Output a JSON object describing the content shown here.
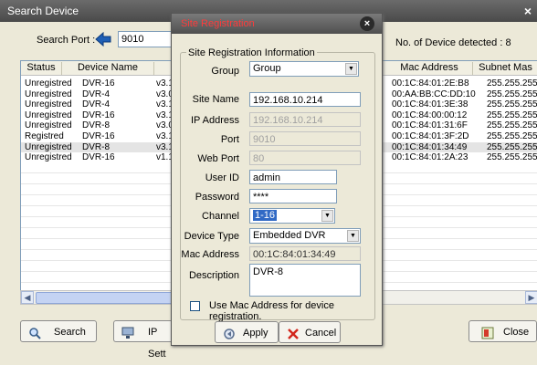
{
  "window": {
    "title": "Search Device",
    "close": "×"
  },
  "search": {
    "port_label": "Search Port :",
    "port_value": "9010",
    "detected_text": "No. of Device detected : 8"
  },
  "table": {
    "headers": [
      "Status",
      "Device Name",
      "",
      "Mac Address",
      "Subnet Mas"
    ],
    "rows": [
      {
        "status": "Unregistred",
        "name": "DVR-16",
        "ver": "v3.1",
        "mac": "00:1C:84:01:2E:B8",
        "subnet": "255.255.255"
      },
      {
        "status": "Unregistred",
        "name": "DVR-4",
        "ver": "v3.0",
        "mac": "00:AA:BB:CC:DD:10",
        "subnet": "255.255.255"
      },
      {
        "status": "Unregistred",
        "name": "DVR-4",
        "ver": "v3.1",
        "mac": "00:1C:84:01:3E:38",
        "subnet": "255.255.255"
      },
      {
        "status": "Unregistred",
        "name": "DVR-16",
        "ver": "v3.1",
        "mac": "00:1C:84:00:00:12",
        "subnet": "255.255.255"
      },
      {
        "status": "Unregistred",
        "name": "DVR-8",
        "ver": "v3.0",
        "mac": "00:1C:84:01:31:6F",
        "subnet": "255.255.255"
      },
      {
        "status": "Registred",
        "name": "DVR-16",
        "ver": "v3.1",
        "mac": "00:1C:84:01:3F:2D",
        "subnet": "255.255.255"
      },
      {
        "status": "Unregistred",
        "name": "DVR-8",
        "ver": "v3.1",
        "mac": "00:1C:84:01:34:49",
        "subnet": "255.255.255"
      },
      {
        "status": "Unregistred",
        "name": "DVR-16",
        "ver": "v1.1",
        "mac": "00:1C:84:01:2A:23",
        "subnet": "255.255.255"
      }
    ]
  },
  "buttons": {
    "search": "Search",
    "ip_setting": "IP Sett",
    "close": "Close"
  },
  "dialog": {
    "title": "Site Registration",
    "close": "×",
    "group_title": "Site Registration Information",
    "labels": {
      "group": "Group",
      "site_name": "Site Name",
      "ip_address": "IP Address",
      "port": "Port",
      "web_port": "Web Port",
      "user_id": "User ID",
      "password": "Password",
      "channel": "Channel",
      "device_type": "Device Type",
      "mac_address": "Mac Address",
      "description": "Description"
    },
    "values": {
      "group": "Group",
      "site_name": "192.168.10.214",
      "ip_address": "192.168.10.214",
      "port": "9010",
      "web_port": "80",
      "user_id": "admin",
      "password": "****",
      "channel": "1-16",
      "device_type": "Embedded DVR",
      "mac_address": "00:1C:84:01:34:49",
      "description": "DVR-8"
    },
    "checkbox_label": "Use Mac Address for device registration.",
    "checkbox_checked": false,
    "apply": "Apply",
    "cancel": "Cancel"
  }
}
